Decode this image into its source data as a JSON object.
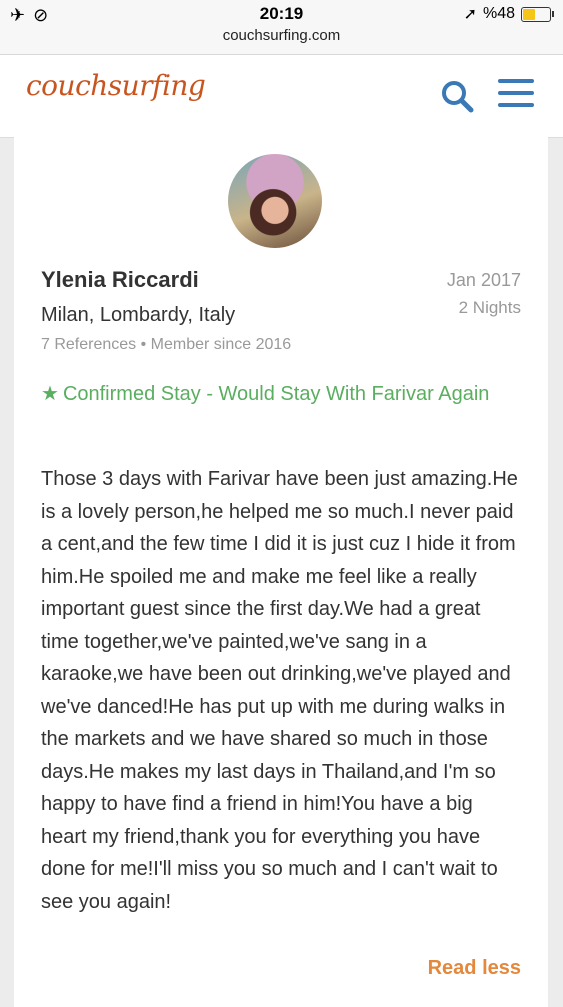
{
  "status_bar": {
    "time": "20:19",
    "battery_label": "%48",
    "battery_level": 0.48,
    "url": "couchsurfing.com"
  },
  "header": {
    "logo": "couchsurfing",
    "brand_color": "#c8551f",
    "icon_color": "#3a79b5"
  },
  "reference": {
    "name": "Ylenia Riccardi",
    "location": "Milan, Lombardy, Italy",
    "meta": "7 References • Member since 2016",
    "date": "Jan 2017",
    "nights": "2 Nights",
    "confirmed": "Confirmed Stay - Would Stay With Farivar Again",
    "body": "Those 3 days with Farivar have been just amazing.He is a lovely person,he helped me so much.I never paid a cent,and the few time I did it is just cuz I hide it from him.He spoiled me and make me feel like a really important guest since the first day.We had a great time together,we've painted,we've sang in a karaoke,we have been out drinking,we've played and we've danced!He has put up with me during walks in the markets and we have shared so much in those days.He makes my last days in Thailand,and I'm so happy to have find a friend in him!You have a big heart my friend,thank you for everything you have done for me!I'll miss you so much and I can't wait to see you again!",
    "read_less": "Read less",
    "accent_green": "#5aae5f",
    "accent_orange": "#e3883c"
  }
}
